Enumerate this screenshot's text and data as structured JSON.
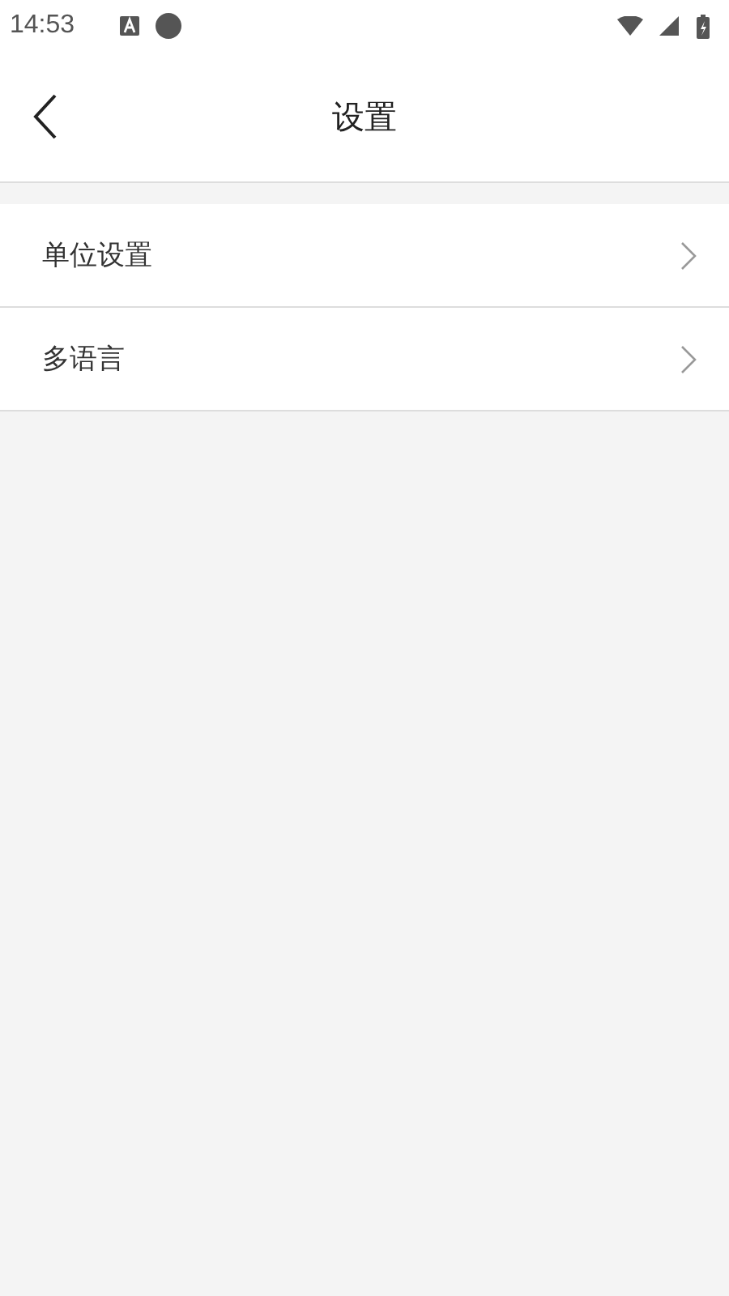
{
  "status_bar": {
    "time": "14:53"
  },
  "header": {
    "title": "设置"
  },
  "items": [
    {
      "label": "单位设置"
    },
    {
      "label": "多语言"
    }
  ]
}
